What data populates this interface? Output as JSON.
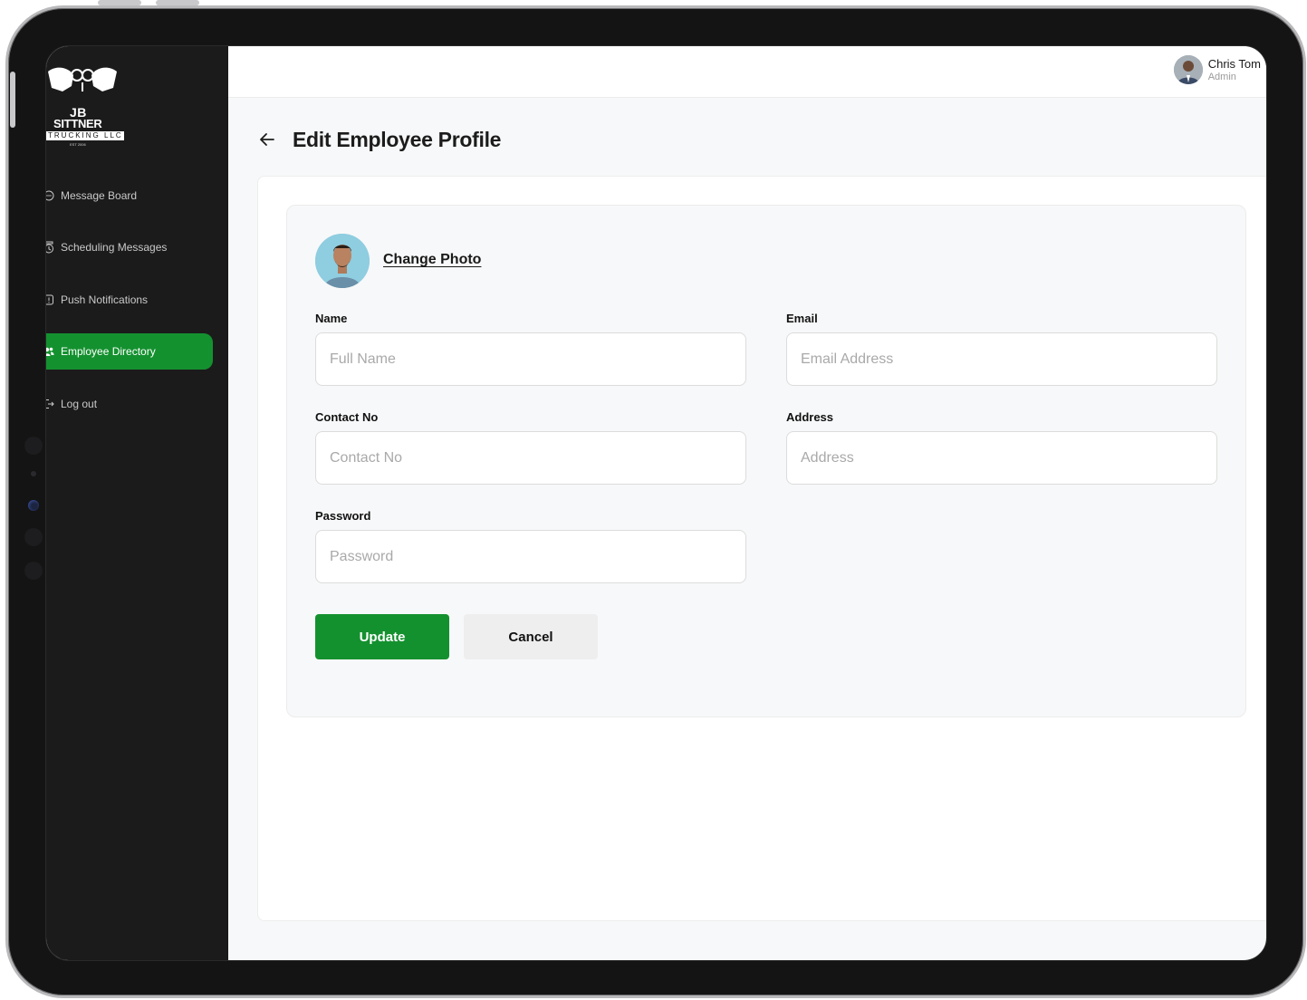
{
  "brand": {
    "logo_line1": "JB",
    "logo_line2": "SITTNER",
    "logo_band": "TRUCKING LLC",
    "logo_est": "EST 2006"
  },
  "sidebar": {
    "items": [
      {
        "label": "Message Board",
        "icon": "message-icon",
        "active": false
      },
      {
        "label": "Scheduling Messages",
        "icon": "clock-icon",
        "active": false
      },
      {
        "label": "Push Notifications",
        "icon": "notification-icon",
        "active": false
      },
      {
        "label": "Employee Directory",
        "icon": "users-icon",
        "active": true
      },
      {
        "label": "Log out",
        "icon": "logout-icon",
        "active": false
      }
    ]
  },
  "user": {
    "name": "Chris Tom",
    "role": "Admin"
  },
  "page": {
    "title": "Edit Employee Profile"
  },
  "form": {
    "change_photo": "Change Photo",
    "fields": {
      "name": {
        "label": "Name",
        "placeholder": "Full Name",
        "value": ""
      },
      "email": {
        "label": "Email",
        "placeholder": "Email Address",
        "value": ""
      },
      "contact": {
        "label": "Contact No",
        "placeholder": "Contact No",
        "value": ""
      },
      "address": {
        "label": "Address",
        "placeholder": "Address",
        "value": ""
      },
      "password": {
        "label": "Password",
        "placeholder": "Password",
        "value": ""
      }
    },
    "update_label": "Update",
    "cancel_label": "Cancel"
  },
  "colors": {
    "accent": "#14912f",
    "sidebar_bg": "#1b1b1b",
    "panel_bg": "#f7f8f9"
  }
}
